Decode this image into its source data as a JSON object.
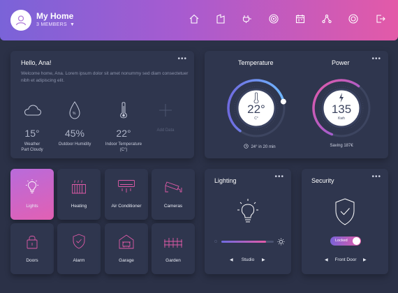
{
  "header": {
    "title": "My Home",
    "members": "3 MEMBERS",
    "nav_icons": [
      "home-icon",
      "rooms-icon",
      "plug-icon",
      "target-icon",
      "calendar-icon",
      "network-icon",
      "settings-icon",
      "logout-icon"
    ]
  },
  "welcome": {
    "title": "Hello, Ana!",
    "text": "Welcome home, Ana. Lorem ipsum dolor sit amet nonummy sed diam consectetuer nibh et adipiscing elit.",
    "stats": [
      {
        "value": "15°",
        "label": "Weather\nPart Cloudy",
        "icon": "cloud-icon"
      },
      {
        "value": "45%",
        "label": "Outdoor Humidity",
        "icon": "drop-icon"
      },
      {
        "value": "22°",
        "label": "Indoor Temperature\n(C°)",
        "icon": "thermometer-icon"
      },
      {
        "value": "",
        "label": "Add Data",
        "icon": "plus-icon"
      }
    ]
  },
  "temperature": {
    "title": "Temperature",
    "value": "22°",
    "unit": "C°",
    "footer": "24° in 20 min",
    "level": 0.82
  },
  "power": {
    "title": "Power",
    "value": "135",
    "unit": "Kwh",
    "footer": "Saving 187€",
    "level": 0.55
  },
  "tiles": [
    {
      "label": "Lights",
      "icon": "bulb-icon",
      "active": true
    },
    {
      "label": "Heating",
      "icon": "radiator-icon",
      "active": false
    },
    {
      "label": "Air Conditioner",
      "icon": "ac-icon",
      "active": false
    },
    {
      "label": "Cameras",
      "icon": "camera-icon",
      "active": false
    },
    {
      "label": "Doors",
      "icon": "lock-icon",
      "active": false
    },
    {
      "label": "Alarm",
      "icon": "shield-icon",
      "active": false
    },
    {
      "label": "Garage",
      "icon": "garage-icon",
      "active": false
    },
    {
      "label": "Garden",
      "icon": "fence-icon",
      "active": false
    }
  ],
  "lighting": {
    "title": "Lighting",
    "brightness": 0.85,
    "selection": "Studio"
  },
  "security": {
    "title": "Security",
    "toggle_label": "Locked",
    "selection": "Front Door"
  },
  "colors": {
    "accent_start": "#7a63d8",
    "accent_end": "#e35aa8",
    "background": "#2b3147",
    "card": "#2f364e"
  }
}
